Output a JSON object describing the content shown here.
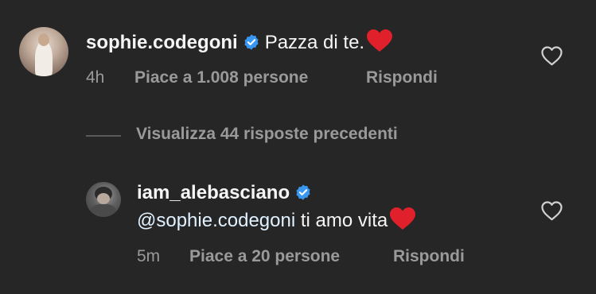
{
  "comments": [
    {
      "username": "sophie.codegoni",
      "text": "Pazza di te.",
      "time": "4h",
      "likes": "Piace a 1.008 persone",
      "reply": "Rispondi"
    },
    {
      "username": "iam_alebasciano",
      "mention": "@sophie.codegoni",
      "text": " ti amo vita",
      "time": "5m",
      "likes": "Piace a 20 persone",
      "reply": "Rispondi"
    }
  ],
  "replies_toggle": {
    "label": "Visualizza 44 risposte precedenti"
  },
  "colors": {
    "background": "#262626",
    "primary_text": "#f5f5f5",
    "secondary_text": "#9a9a9a",
    "verified_blue": "#3897f0",
    "heart_red": "#e0202a"
  },
  "icons": {
    "verified": "verified-badge-icon",
    "like": "heart-outline-icon",
    "emoji": "red-heart-emoji-icon"
  }
}
